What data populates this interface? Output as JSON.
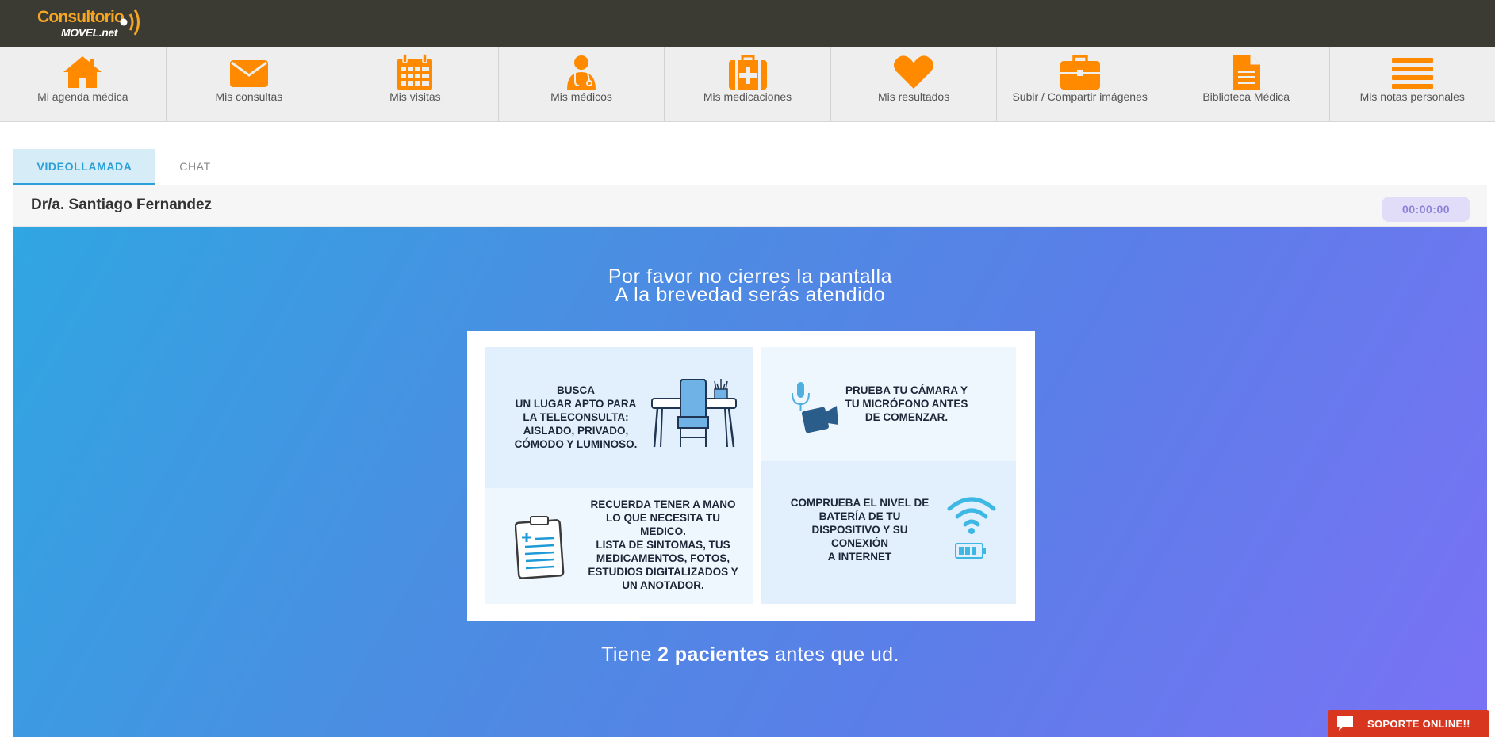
{
  "brand": {
    "logo_top": "Consultorio",
    "logo_bottom": "MOVEL.net",
    "accent": "#ff8a00"
  },
  "nav": {
    "items": [
      {
        "label": "Mi agenda médica",
        "icon": "home-icon"
      },
      {
        "label": "Mis consultas",
        "icon": "envelope-icon"
      },
      {
        "label": "Mis visitas",
        "icon": "calendar-icon"
      },
      {
        "label": "Mis médicos",
        "icon": "doctor-icon"
      },
      {
        "label": "Mis medicaciones",
        "icon": "medkit-icon"
      },
      {
        "label": "Mis resultados",
        "icon": "heart-icon"
      },
      {
        "label": "Subir / Compartir imágenes",
        "icon": "briefcase-icon"
      },
      {
        "label": "Biblioteca Médica",
        "icon": "document-icon"
      },
      {
        "label": "Mis notas personales",
        "icon": "menu-lines-icon"
      }
    ]
  },
  "tabs": {
    "video": "VIDEOLLAMADA",
    "chat": "CHAT",
    "active": "VIDEOLLAMADA"
  },
  "doctor": {
    "name": "Dr/a. Santiago Fernandez",
    "timer": "00:00:00"
  },
  "panel": {
    "line1": "Por favor no cierres la pantalla",
    "line2": "A la brevedad serás atendido",
    "queue_prefix": "Tiene ",
    "queue_count": "2 pacientes",
    "queue_suffix": " antes que ud."
  },
  "tips": {
    "place": "BUSCA\nUN LUGAR APTO PARA\nLA TELECONSULTA:\nAISLADO, PRIVADO,\nCÓMODO  Y LUMINOSO.",
    "camera": "PRUEBA TU CÁMARA Y\nTU MICRÓFONO ANTES\nDE COMENZAR.",
    "checklist": "RECUERDA TENER A MANO\nLO QUE NECESITA TU\nMEDICO.\nLISTA DE SINTOMAS, TUS\nMEDICAMENTOS, FOTOS,\nESTUDIOS DIGITALIZADOS Y\nUN  ANOTADOR.",
    "battery": "COMPRUEBA EL NIVEL DE\nBATERÍA DE TU\nDISPOSITIVO Y SU\nCONEXIÓN\nA INTERNET"
  },
  "support": {
    "label": "SOPORTE ONLINE!!",
    "color": "#d9361f"
  }
}
